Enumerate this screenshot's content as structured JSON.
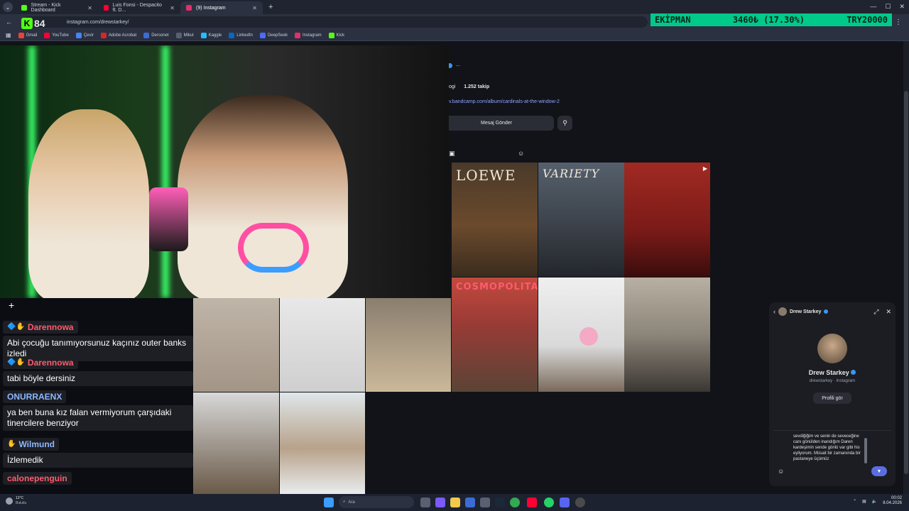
{
  "browser": {
    "tabs": [
      {
        "label": "Stream - Kick Dashboard",
        "color": "#53fc18"
      },
      {
        "label": "Luis Fonsi - Despacito ft. D...",
        "color": "#ff0033"
      },
      {
        "label": "(9) Instagram",
        "color": "#e1306c"
      }
    ],
    "new_tab": "+",
    "url": "instagram.com/drewstarkey/",
    "bookmarks": [
      "Gmail",
      "YouTube",
      "Çevir",
      "Adobe Acrobat",
      "Dersonet",
      "Mikul",
      "Kaggle",
      "LinkedIn",
      "DeepSeek",
      "Instagram",
      "Kick"
    ]
  },
  "overlay": {
    "channel_number": "84",
    "channel_logo": "K",
    "ticker": {
      "label": "EKİPMAN",
      "amount": "3460₺ (17.30%)",
      "goal": "TRY20000"
    }
  },
  "instagram": {
    "more": "...",
    "followers_label": "ogi",
    "following": "1.252 takip",
    "link": "v.bandcamp.com/album/cardinals-at-the-window-2",
    "message_button": "Mesaj Gönder",
    "tiles": [
      {
        "caption": "LOEWE",
        "tone": "#6b4a2c"
      },
      {
        "caption": "VARIETY",
        "tone": "#3a3f47"
      },
      {
        "caption": "",
        "tone": "#7a1a18"
      },
      {
        "caption": "COSMOPOLITAN",
        "tone": "#9a3b36"
      },
      {
        "caption": "",
        "tone": "#d9d9d9"
      },
      {
        "caption": "",
        "tone": "#8c8579"
      }
    ]
  },
  "chat": {
    "messages": [
      {
        "user": "Darennowa",
        "user_color": "#ff5b6e",
        "text": "Abi çocuğu tanımıyorsunuz kaçınız outer banks izledi"
      },
      {
        "user": "Darennowa",
        "user_color": "#ff5b6e",
        "text": "tabi böyle dersiniz"
      },
      {
        "user": "ONURRAENX",
        "user_color": "#8eb7ff",
        "text": "ya ben buna kız falan vermiyorum çarşıdaki tinercilere benziyor"
      },
      {
        "user": "Wilmund",
        "user_color": "#8eb7ff",
        "text": "İzlemedik"
      },
      {
        "user": "calonepenguin",
        "user_color": "#ff5b6e",
        "text": ""
      }
    ]
  },
  "dm_panel": {
    "name": "Drew Starkey",
    "handle": "drewstarkey · Instagram",
    "profile_button": "Profili gör",
    "draft": "sevdiğiğim ve senin de seveceğine canı gönülden inandığım Daren kardeşimin sende gönlü var gibi his eyliyorum. Müsait bir zamanında bir pastaneye üçümüz"
  },
  "taskbar": {
    "weather_temp": "12°C",
    "weather_label": "Bulutlu",
    "search": "Ara",
    "time": "00:02",
    "date": "8.04.2026"
  }
}
